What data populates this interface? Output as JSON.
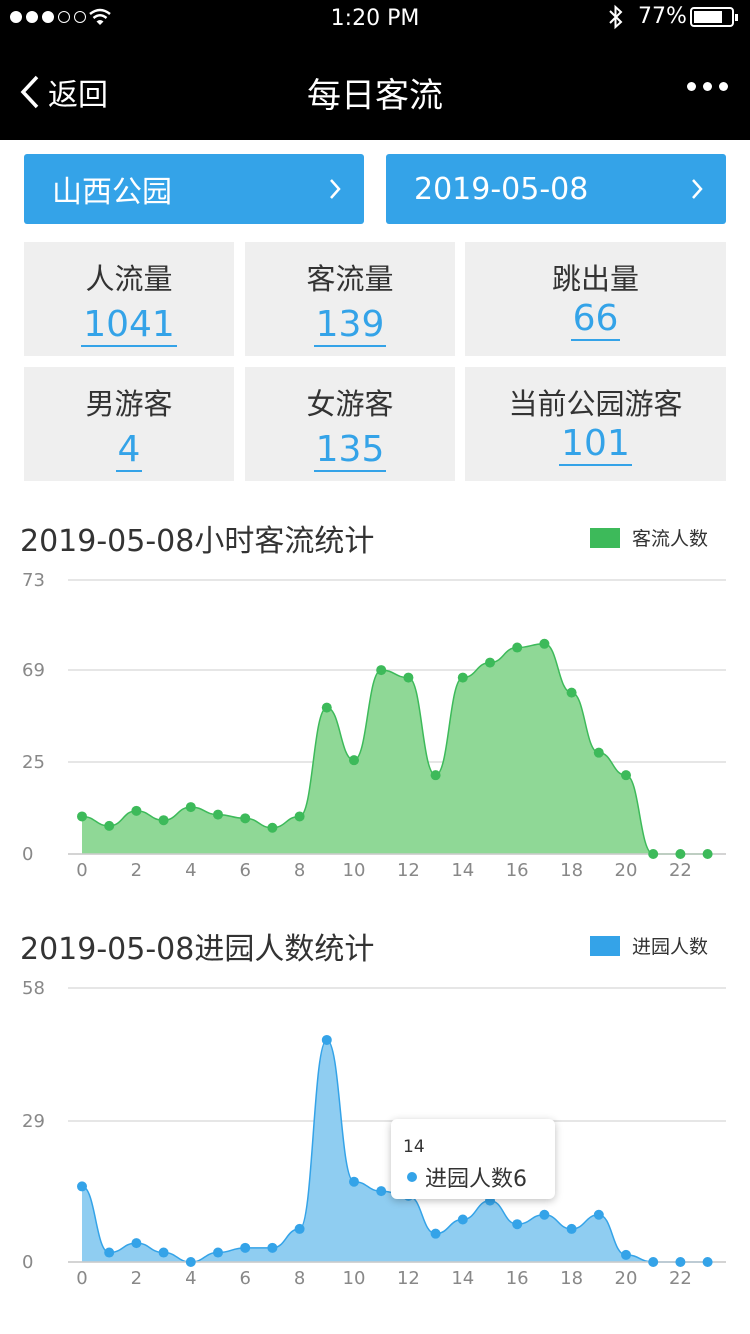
{
  "status_bar": {
    "time": "1:20 PM",
    "battery": "77%",
    "battery_level": 0.77
  },
  "nav": {
    "back_label": "返回",
    "title": "每日客流"
  },
  "selectors": {
    "park": "山西公园",
    "date": "2019-05-08"
  },
  "stats": [
    {
      "label": "人流量",
      "value": "1041"
    },
    {
      "label": "客流量",
      "value": "139"
    },
    {
      "label": "跳出量",
      "value": "66"
    },
    {
      "label": "男游客",
      "value": "4"
    },
    {
      "label": "女游客",
      "value": "135"
    },
    {
      "label": "当前公园游客",
      "value": "101"
    }
  ],
  "colors": {
    "accent": "#34a3e8",
    "green": "#3dba5a",
    "green_fill": "#8fd896",
    "blue_fill": "#8fcdf1",
    "stat_bg": "#efefef"
  },
  "chart_data": [
    {
      "type": "area",
      "title": "2019-05-08小时客流统计",
      "legend": "客流人数",
      "x": [
        0,
        1,
        2,
        3,
        4,
        5,
        6,
        7,
        8,
        9,
        10,
        11,
        12,
        13,
        14,
        15,
        16,
        17,
        18,
        19,
        20,
        21,
        22,
        23
      ],
      "x_tick_labels": [
        "0",
        "2",
        "4",
        "6",
        "8",
        "10",
        "12",
        "14",
        "16",
        "18",
        "20",
        "22"
      ],
      "y_tick_labels": [
        "0",
        "25",
        "69",
        "73"
      ],
      "series": [
        {
          "name": "客流人数",
          "values": [
            10,
            7.5,
            11.5,
            9,
            12.5,
            10.5,
            9.5,
            7,
            10,
            39,
            25,
            49,
            47,
            21,
            47,
            51,
            55,
            56,
            43,
            27,
            21,
            0,
            0,
            0
          ]
        }
      ],
      "ylim": [
        0,
        73
      ]
    },
    {
      "type": "area",
      "title": "2019-05-08进园人数统计",
      "legend": "进园人数",
      "x": [
        0,
        1,
        2,
        3,
        4,
        5,
        6,
        7,
        8,
        9,
        10,
        11,
        12,
        13,
        14,
        15,
        16,
        17,
        18,
        19,
        20,
        21,
        22,
        23
      ],
      "x_tick_labels": [
        "0",
        "2",
        "4",
        "6",
        "8",
        "10",
        "12",
        "14",
        "16",
        "18",
        "20",
        "22"
      ],
      "y_tick_labels": [
        "0",
        "29",
        "58"
      ],
      "series": [
        {
          "name": "进园人数",
          "values": [
            16,
            2,
            4,
            2,
            0,
            2,
            3,
            3,
            7,
            47,
            17,
            15,
            14,
            6,
            9,
            13,
            8,
            10,
            7,
            10,
            1.5,
            0,
            0,
            0
          ]
        }
      ],
      "ylim": [
        0,
        58
      ],
      "tooltip": {
        "x": "14",
        "series": "进园人数",
        "value": "6"
      }
    }
  ]
}
